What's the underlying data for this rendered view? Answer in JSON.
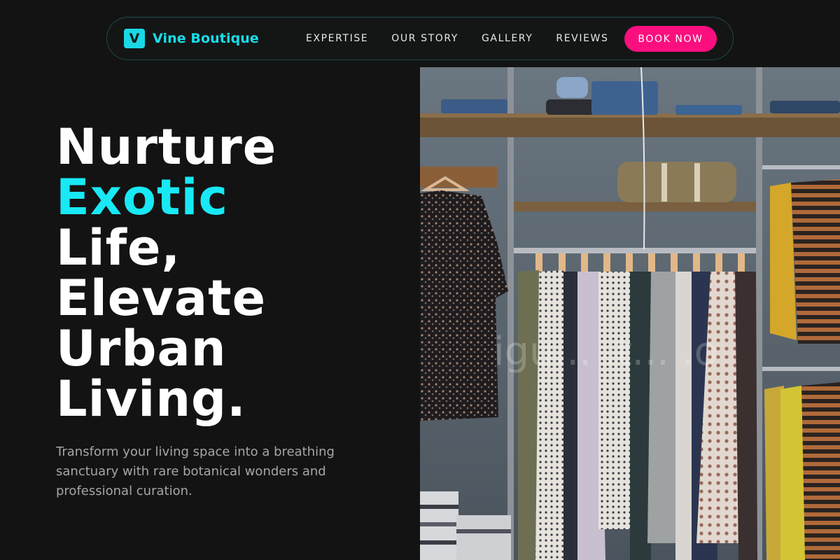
{
  "brand": {
    "logo_letter": "V",
    "name": "Vine Boutique"
  },
  "nav": {
    "items": [
      "EXPERTISE",
      "OUR STORY",
      "GALLERY",
      "REVIEWS"
    ],
    "cta": "BOOK NOW"
  },
  "hero": {
    "lines": [
      "Nurture",
      "Exotic",
      "Life,",
      "Elevate",
      "Urban",
      "Living."
    ],
    "accent_line": "Exotic",
    "subtitle": "Transform your living space into a breathing sanctuary with rare botanical wonders and professional curation."
  },
  "image": {
    "subject": "clothing-rack-photo",
    "watermark": "igu... .t... .o"
  },
  "colors": {
    "background": "#131313",
    "accent_cyan": "#19e8f5",
    "cta_pink": "#fb0f7e",
    "text_muted": "#a6a6a6"
  }
}
